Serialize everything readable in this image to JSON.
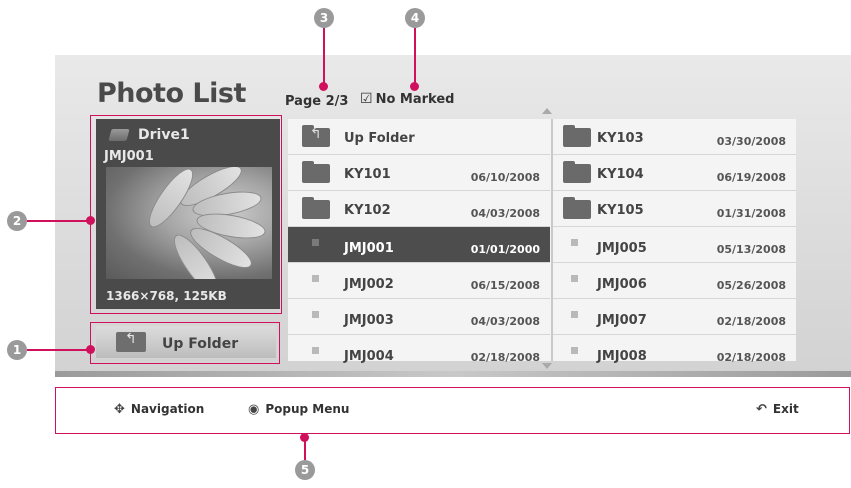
{
  "title": "Photo List",
  "page_info": "Page 2/3",
  "marked_label": "No Marked",
  "preview": {
    "drive_label": "Drive1",
    "file_label": "JMJ001",
    "resolution_size": "1366×768, 125KB"
  },
  "up_folder_button_label": "Up Folder",
  "list": {
    "col1": [
      {
        "type": "up",
        "name": "Up Folder",
        "date": ""
      },
      {
        "type": "folder",
        "name": "KY101",
        "date": "06/10/2008"
      },
      {
        "type": "folder",
        "name": "KY102",
        "date": "04/03/2008"
      },
      {
        "type": "file",
        "name": "JMJ001",
        "date": "01/01/2000",
        "selected": true
      },
      {
        "type": "file",
        "name": "JMJ002",
        "date": "06/15/2008"
      },
      {
        "type": "file",
        "name": "JMJ003",
        "date": "04/03/2008"
      },
      {
        "type": "file",
        "name": "JMJ004",
        "date": "02/18/2008"
      }
    ],
    "col2": [
      {
        "type": "folder",
        "name": "KY103",
        "date": "03/30/2008"
      },
      {
        "type": "folder",
        "name": "KY104",
        "date": "06/19/2008"
      },
      {
        "type": "folder",
        "name": "KY105",
        "date": "01/31/2008"
      },
      {
        "type": "file",
        "name": "JMJ005",
        "date": "05/13/2008"
      },
      {
        "type": "file",
        "name": "JMJ006",
        "date": "05/26/2008"
      },
      {
        "type": "file",
        "name": "JMJ007",
        "date": "02/18/2008"
      },
      {
        "type": "file",
        "name": "JMJ008",
        "date": "02/18/2008"
      }
    ]
  },
  "navbar": {
    "navigation_label": "Navigation",
    "popup_label": "Popup Menu",
    "exit_label": "Exit"
  },
  "badges": [
    "1",
    "2",
    "3",
    "4",
    "5"
  ],
  "colors": {
    "annotation": "#d0105d",
    "selected_row": "#4d4d4d",
    "badge": "#9a9a9a"
  }
}
